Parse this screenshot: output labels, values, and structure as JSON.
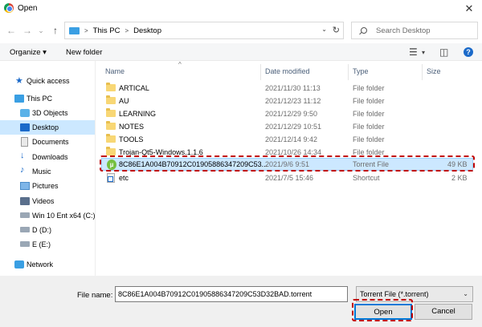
{
  "window": {
    "title": "Open",
    "close_glyph": "✕"
  },
  "nav": {
    "back_glyph": "←",
    "forward_glyph": "→",
    "dropdown_glyph": "⌄",
    "up_glyph": "↑",
    "breadcrumb": [
      "This PC",
      "Desktop"
    ],
    "search_placeholder": "Search Desktop"
  },
  "toolbar": {
    "organize": "Organize ▾",
    "new_folder": "New folder",
    "view_glyph": "☰",
    "pane_glyph": "◫",
    "help_glyph": "?"
  },
  "sidebar": {
    "items": [
      {
        "label": "Quick access",
        "icon": "star-icon"
      },
      {
        "label": "This PC",
        "icon": "computer-icon"
      },
      {
        "label": "3D Objects",
        "icon": "cube-icon"
      },
      {
        "label": "Desktop",
        "icon": "desktop-icon",
        "selected": true
      },
      {
        "label": "Documents",
        "icon": "document-icon"
      },
      {
        "label": "Downloads",
        "icon": "download-icon"
      },
      {
        "label": "Music",
        "icon": "music-icon"
      },
      {
        "label": "Pictures",
        "icon": "picture-icon"
      },
      {
        "label": "Videos",
        "icon": "video-icon"
      },
      {
        "label": "Win 10 Ent x64 (C:)",
        "icon": "drive-icon"
      },
      {
        "label": "D (D:)",
        "icon": "drive-icon"
      },
      {
        "label": "E (E:)",
        "icon": "drive-icon"
      },
      {
        "label": "Network",
        "icon": "network-icon"
      }
    ]
  },
  "columns": {
    "name": "Name",
    "date": "Date modified",
    "type": "Type",
    "size": "Size",
    "sort_glyph": "^"
  },
  "files": [
    {
      "name": "ARTICAL",
      "date": "2021/11/30 11:13",
      "type": "File folder",
      "size": "",
      "kind": "folder"
    },
    {
      "name": "AU",
      "date": "2021/12/23 11:12",
      "type": "File folder",
      "size": "",
      "kind": "folder"
    },
    {
      "name": "LEARNING",
      "date": "2021/12/29 9:50",
      "type": "File folder",
      "size": "",
      "kind": "folder"
    },
    {
      "name": "NOTES",
      "date": "2021/12/29 10:51",
      "type": "File folder",
      "size": "",
      "kind": "folder"
    },
    {
      "name": "TOOLS",
      "date": "2021/12/14 9:42",
      "type": "File folder",
      "size": "",
      "kind": "folder"
    },
    {
      "name": "Trojan-Qt5-Windows.1.1.6",
      "date": "2021/10/26 14:34",
      "type": "File folder",
      "size": "",
      "kind": "folder"
    },
    {
      "name": "8C86E1A004B70912C01905886347209C53...",
      "date": "2021/9/6 9:51",
      "type": "Torrent File",
      "size": "49 KB",
      "kind": "torrent",
      "selected": true
    },
    {
      "name": "etc",
      "date": "2021/7/5 15:46",
      "type": "Shortcut",
      "size": "2 KB",
      "kind": "shortcut"
    }
  ],
  "footer": {
    "filename_label": "File name:",
    "filename_value": "8C86E1A004B70912C01905886347209C53D32BAD.torrent",
    "filetype": "Torrent File (*.torrent)",
    "filetype_chev": "⌄",
    "open_label": "Open",
    "cancel_label": "Cancel"
  },
  "colors": {
    "selection": "#cce8ff",
    "highlight_dash": "#c00000",
    "accent": "#0078d7"
  }
}
